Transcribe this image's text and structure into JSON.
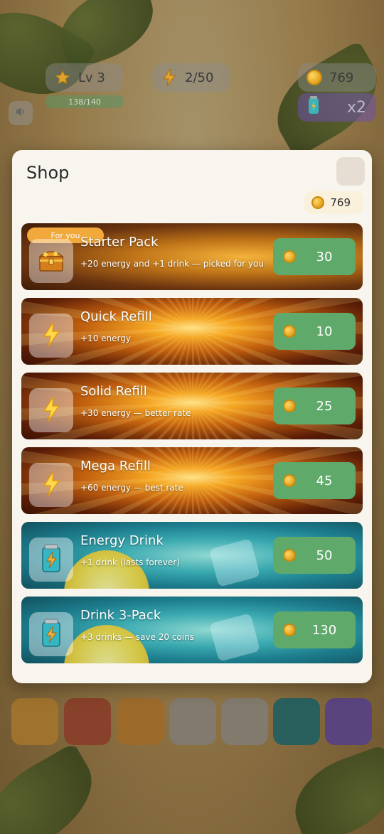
{
  "hud": {
    "level_label": "Lv 3",
    "xp_progress": "138/140",
    "energy": "2/50",
    "coins": "769",
    "boost_multiplier": "x2"
  },
  "shop": {
    "title": "Shop",
    "balance": "769",
    "items": [
      {
        "title": "Starter Pack",
        "badge": "For you",
        "description": "+20 energy and +1 drink — picked for you",
        "price": "30",
        "theme": "treasure",
        "icon": "treasure-chest-icon"
      },
      {
        "title": "Quick Refill",
        "description": "+10 energy",
        "price": "10",
        "theme": "fire",
        "icon": "lightning-bolt-icon"
      },
      {
        "title": "Solid Refill",
        "description": "+30 energy — better rate",
        "price": "25",
        "theme": "fire",
        "icon": "lightning-bolt-icon"
      },
      {
        "title": "Mega Refill",
        "description": "+60 energy — best rate",
        "price": "45",
        "theme": "fire",
        "icon": "lightning-bolt-icon"
      },
      {
        "title": "Energy Drink",
        "description": "+1 drink (lasts forever)",
        "price": "50",
        "theme": "aqua",
        "icon": "energy-drink-can-icon"
      },
      {
        "title": "Drink 3-Pack",
        "description": "+3 drinks — save 20 coins",
        "price": "130",
        "theme": "aqua",
        "icon": "energy-drink-can-icon"
      }
    ]
  },
  "colors": {
    "buy_button": "#5fa96b",
    "ribbon": "#f0a93a",
    "modal_bg": "#f8f5ee"
  }
}
